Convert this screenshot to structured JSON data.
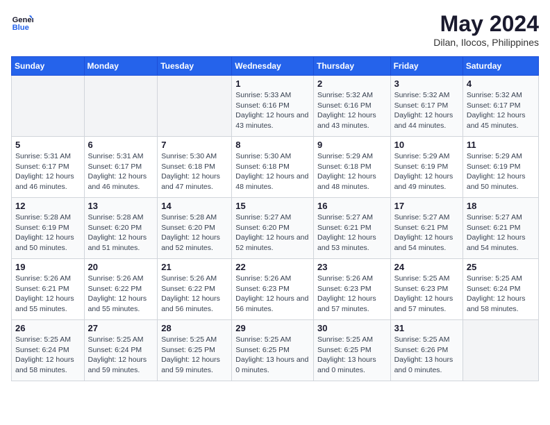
{
  "header": {
    "logo_line1": "General",
    "logo_line2": "Blue",
    "month_year": "May 2024",
    "location": "Dilan, Ilocos, Philippines"
  },
  "weekdays": [
    "Sunday",
    "Monday",
    "Tuesday",
    "Wednesday",
    "Thursday",
    "Friday",
    "Saturday"
  ],
  "weeks": [
    [
      {
        "day": "",
        "sunrise": "",
        "sunset": "",
        "daylight": ""
      },
      {
        "day": "",
        "sunrise": "",
        "sunset": "",
        "daylight": ""
      },
      {
        "day": "",
        "sunrise": "",
        "sunset": "",
        "daylight": ""
      },
      {
        "day": "1",
        "sunrise": "Sunrise: 5:33 AM",
        "sunset": "Sunset: 6:16 PM",
        "daylight": "Daylight: 12 hours and 43 minutes."
      },
      {
        "day": "2",
        "sunrise": "Sunrise: 5:32 AM",
        "sunset": "Sunset: 6:16 PM",
        "daylight": "Daylight: 12 hours and 43 minutes."
      },
      {
        "day": "3",
        "sunrise": "Sunrise: 5:32 AM",
        "sunset": "Sunset: 6:17 PM",
        "daylight": "Daylight: 12 hours and 44 minutes."
      },
      {
        "day": "4",
        "sunrise": "Sunrise: 5:32 AM",
        "sunset": "Sunset: 6:17 PM",
        "daylight": "Daylight: 12 hours and 45 minutes."
      }
    ],
    [
      {
        "day": "5",
        "sunrise": "Sunrise: 5:31 AM",
        "sunset": "Sunset: 6:17 PM",
        "daylight": "Daylight: 12 hours and 46 minutes."
      },
      {
        "day": "6",
        "sunrise": "Sunrise: 5:31 AM",
        "sunset": "Sunset: 6:17 PM",
        "daylight": "Daylight: 12 hours and 46 minutes."
      },
      {
        "day": "7",
        "sunrise": "Sunrise: 5:30 AM",
        "sunset": "Sunset: 6:18 PM",
        "daylight": "Daylight: 12 hours and 47 minutes."
      },
      {
        "day": "8",
        "sunrise": "Sunrise: 5:30 AM",
        "sunset": "Sunset: 6:18 PM",
        "daylight": "Daylight: 12 hours and 48 minutes."
      },
      {
        "day": "9",
        "sunrise": "Sunrise: 5:29 AM",
        "sunset": "Sunset: 6:18 PM",
        "daylight": "Daylight: 12 hours and 48 minutes."
      },
      {
        "day": "10",
        "sunrise": "Sunrise: 5:29 AM",
        "sunset": "Sunset: 6:19 PM",
        "daylight": "Daylight: 12 hours and 49 minutes."
      },
      {
        "day": "11",
        "sunrise": "Sunrise: 5:29 AM",
        "sunset": "Sunset: 6:19 PM",
        "daylight": "Daylight: 12 hours and 50 minutes."
      }
    ],
    [
      {
        "day": "12",
        "sunrise": "Sunrise: 5:28 AM",
        "sunset": "Sunset: 6:19 PM",
        "daylight": "Daylight: 12 hours and 50 minutes."
      },
      {
        "day": "13",
        "sunrise": "Sunrise: 5:28 AM",
        "sunset": "Sunset: 6:20 PM",
        "daylight": "Daylight: 12 hours and 51 minutes."
      },
      {
        "day": "14",
        "sunrise": "Sunrise: 5:28 AM",
        "sunset": "Sunset: 6:20 PM",
        "daylight": "Daylight: 12 hours and 52 minutes."
      },
      {
        "day": "15",
        "sunrise": "Sunrise: 5:27 AM",
        "sunset": "Sunset: 6:20 PM",
        "daylight": "Daylight: 12 hours and 52 minutes."
      },
      {
        "day": "16",
        "sunrise": "Sunrise: 5:27 AM",
        "sunset": "Sunset: 6:21 PM",
        "daylight": "Daylight: 12 hours and 53 minutes."
      },
      {
        "day": "17",
        "sunrise": "Sunrise: 5:27 AM",
        "sunset": "Sunset: 6:21 PM",
        "daylight": "Daylight: 12 hours and 54 minutes."
      },
      {
        "day": "18",
        "sunrise": "Sunrise: 5:27 AM",
        "sunset": "Sunset: 6:21 PM",
        "daylight": "Daylight: 12 hours and 54 minutes."
      }
    ],
    [
      {
        "day": "19",
        "sunrise": "Sunrise: 5:26 AM",
        "sunset": "Sunset: 6:21 PM",
        "daylight": "Daylight: 12 hours and 55 minutes."
      },
      {
        "day": "20",
        "sunrise": "Sunrise: 5:26 AM",
        "sunset": "Sunset: 6:22 PM",
        "daylight": "Daylight: 12 hours and 55 minutes."
      },
      {
        "day": "21",
        "sunrise": "Sunrise: 5:26 AM",
        "sunset": "Sunset: 6:22 PM",
        "daylight": "Daylight: 12 hours and 56 minutes."
      },
      {
        "day": "22",
        "sunrise": "Sunrise: 5:26 AM",
        "sunset": "Sunset: 6:23 PM",
        "daylight": "Daylight: 12 hours and 56 minutes."
      },
      {
        "day": "23",
        "sunrise": "Sunrise: 5:26 AM",
        "sunset": "Sunset: 6:23 PM",
        "daylight": "Daylight: 12 hours and 57 minutes."
      },
      {
        "day": "24",
        "sunrise": "Sunrise: 5:25 AM",
        "sunset": "Sunset: 6:23 PM",
        "daylight": "Daylight: 12 hours and 57 minutes."
      },
      {
        "day": "25",
        "sunrise": "Sunrise: 5:25 AM",
        "sunset": "Sunset: 6:24 PM",
        "daylight": "Daylight: 12 hours and 58 minutes."
      }
    ],
    [
      {
        "day": "26",
        "sunrise": "Sunrise: 5:25 AM",
        "sunset": "Sunset: 6:24 PM",
        "daylight": "Daylight: 12 hours and 58 minutes."
      },
      {
        "day": "27",
        "sunrise": "Sunrise: 5:25 AM",
        "sunset": "Sunset: 6:24 PM",
        "daylight": "Daylight: 12 hours and 59 minutes."
      },
      {
        "day": "28",
        "sunrise": "Sunrise: 5:25 AM",
        "sunset": "Sunset: 6:25 PM",
        "daylight": "Daylight: 12 hours and 59 minutes."
      },
      {
        "day": "29",
        "sunrise": "Sunrise: 5:25 AM",
        "sunset": "Sunset: 6:25 PM",
        "daylight": "Daylight: 13 hours and 0 minutes."
      },
      {
        "day": "30",
        "sunrise": "Sunrise: 5:25 AM",
        "sunset": "Sunset: 6:25 PM",
        "daylight": "Daylight: 13 hours and 0 minutes."
      },
      {
        "day": "31",
        "sunrise": "Sunrise: 5:25 AM",
        "sunset": "Sunset: 6:26 PM",
        "daylight": "Daylight: 13 hours and 0 minutes."
      },
      {
        "day": "",
        "sunrise": "",
        "sunset": "",
        "daylight": ""
      }
    ]
  ]
}
